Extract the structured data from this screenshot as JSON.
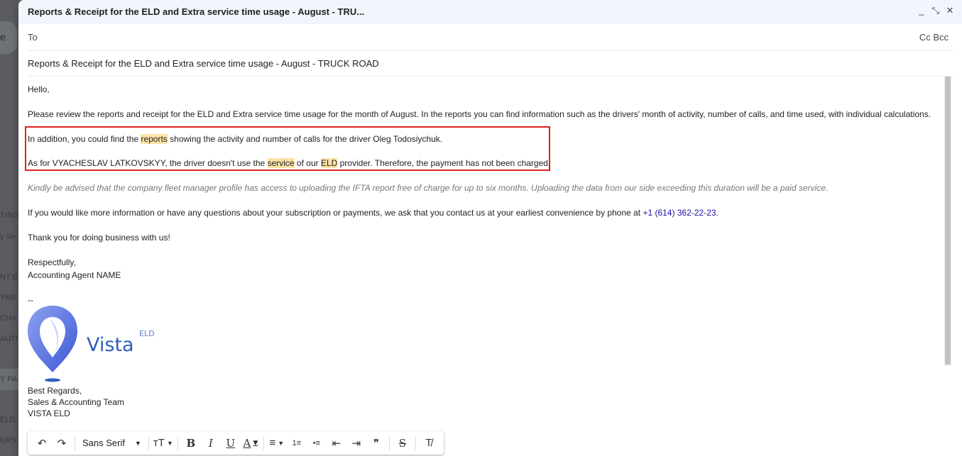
{
  "window": {
    "title": "Reports & Receipt for the ELD and Extra service time usage - August - TRU..."
  },
  "controls": {
    "minimize": "_",
    "expand": "⤡",
    "close": "✕"
  },
  "background_fragments": [
    "e",
    "TING",
    "y Se",
    "NT E",
    "YME",
    "CHA",
    "AUTO",
    "Y PA",
    "ELD",
    "ERS"
  ],
  "fields": {
    "to_label": "To",
    "cc_bcc": "Cc Bcc",
    "subject": "Reports & Receipt for the ELD and Extra service time usage - August - TRUCK ROAD"
  },
  "body": {
    "greeting": "Hello,",
    "para1": "Please review the reports and receipt for the ELD and Extra service time usage for the month of August. In the reports you can find information such as the drivers' month of activity, number of calls, and time used, with individual calculations.",
    "para2_a": "In addition, you could find the ",
    "para2_hl": "reports",
    "para2_b": " showing the activity and number of calls for the driver Oleg Todosiychuk.",
    "para3_a": "As for VYACHESLAV LATKOVSKYY, the driver doesn't use the ",
    "para3_hl1": "service",
    "para3_b": " of our ",
    "para3_hl2": "ELD",
    "para3_c": " provider. Therefore, the payment has not been charged.",
    "para4": "Kindly be advised that the company fleet manager profile has access to uploading the IFTA report free of charge for up to six months. Uploading the data from our side exceeding this duration will be a paid service.",
    "para5_a": "If you would like more information or have any questions about your subscription or payments, we ask that you contact us at your earliest convenience by phone at ",
    "para5_phone": "+1 (614) 362-22-23",
    "para5_b": ".",
    "thanks": "Thank you for doing business with us!",
    "sign1": "Respectfully,",
    "sign2": "Accounting  Agent  NAME",
    "dash": "--",
    "logo_text": "Vista",
    "logo_sup": "ELD",
    "regards1": "Best Regards,",
    "regards2": "Sales & Accounting Team",
    "regards3": "VISTA ELD"
  },
  "toolbar": {
    "undo": "↶",
    "redo": "↷",
    "font": "Sans Serif",
    "size": "тT",
    "bold": "B",
    "italic": "I",
    "underline": "U",
    "textcolor": "A",
    "align": "≡",
    "numbered": "1≡",
    "bulleted": "•≡",
    "outdent": "⇤",
    "indent": "⇥",
    "quote": "❞",
    "strike": "S",
    "clear": "T̸"
  },
  "colors": {
    "highlight": "#fbe3a6",
    "redbox": "#d9231c",
    "link": "#1a0dab",
    "logo": "#2f5fb7"
  }
}
